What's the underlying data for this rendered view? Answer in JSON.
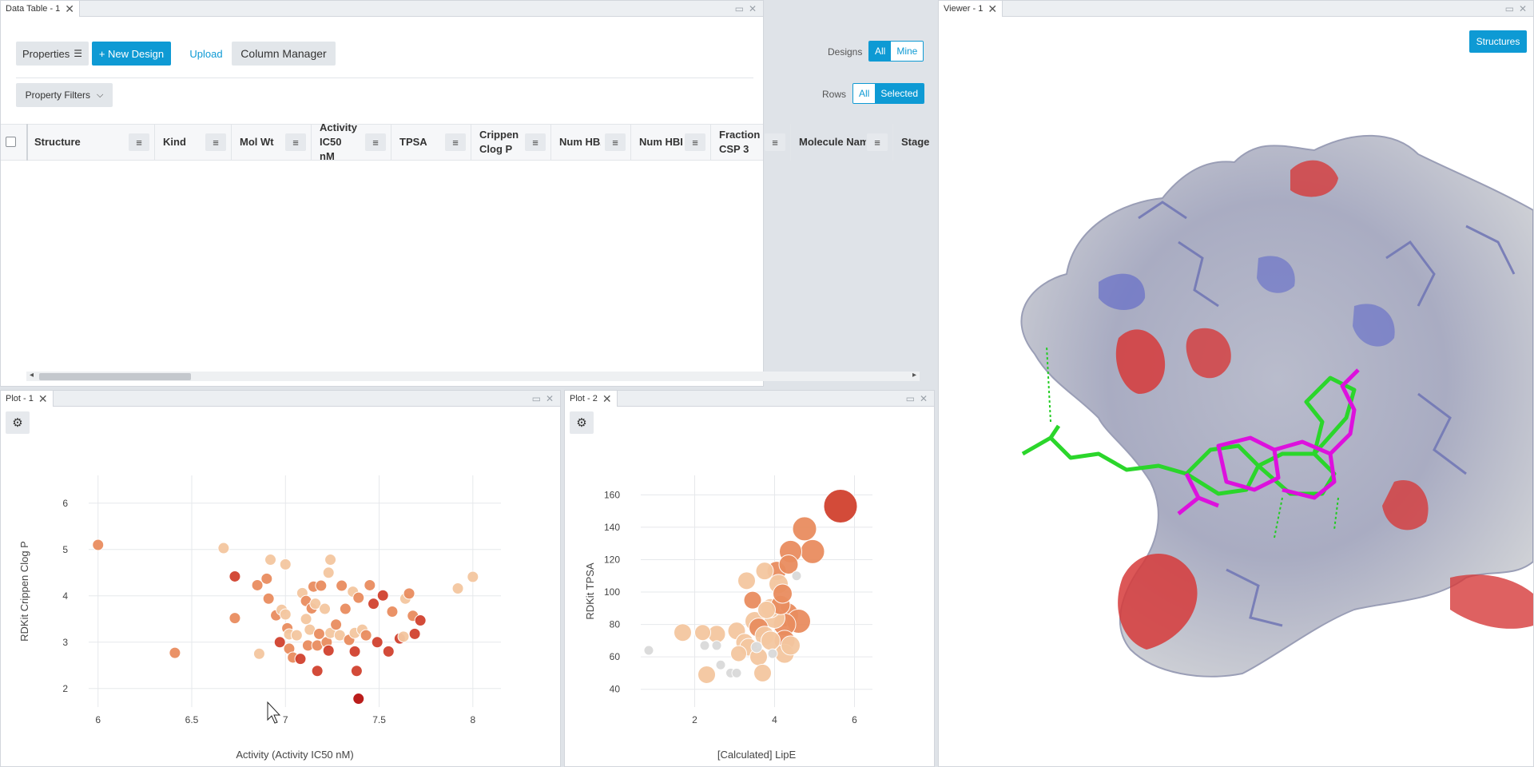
{
  "data_table": {
    "tab_title": "Data Table - 1",
    "properties_label": "Properties",
    "new_design_label": "+ New Design",
    "upload_label": "Upload",
    "column_manager_label": "Column Manager",
    "designs_label": "Designs",
    "designs_all": "All",
    "designs_mine": "Mine",
    "property_filters_label": "Property Filters",
    "rows_label": "Rows",
    "rows_all": "All",
    "rows_selected": "Selected",
    "columns": [
      {
        "label": "Structure"
      },
      {
        "label": "Kind"
      },
      {
        "label": "Mol Wt"
      },
      {
        "label": "Activity IC50\nnM"
      },
      {
        "label": "TPSA"
      },
      {
        "label": "Crippen\nClog P"
      },
      {
        "label": "Num HBA"
      },
      {
        "label": "Num HBD"
      },
      {
        "label": "Fraction\nCSP 3"
      },
      {
        "label": "Molecule Name"
      },
      {
        "label": "Stage"
      }
    ]
  },
  "plot1": {
    "tab_title": "Plot - 1",
    "icons": {
      "settings": "gear-icon"
    }
  },
  "plot2": {
    "tab_title": "Plot - 2",
    "icons": {
      "settings": "gear-icon"
    }
  },
  "viewer": {
    "tab_title": "Viewer - 1",
    "structures_label": "Structures"
  },
  "chart_data": [
    {
      "type": "scatter",
      "xlabel": "Activity (Activity IC50 nM)",
      "ylabel": "RDKit Crippen Clog P",
      "xlim": [
        5.95,
        8.15
      ],
      "ylim": [
        1.6,
        6.6
      ],
      "xticks": [
        6,
        6.5,
        7,
        7.5,
        8
      ],
      "yticks": [
        2,
        3,
        4,
        5,
        6
      ],
      "grid": true,
      "colors": [
        "#f4c7a0",
        "#e98d5f",
        "#d1422f",
        "#b7110f"
      ],
      "points": [
        {
          "x": 6.0,
          "y": 5.1,
          "c": 1
        },
        {
          "x": 6.41,
          "y": 2.77,
          "c": 1
        },
        {
          "x": 6.67,
          "y": 5.03,
          "c": 0
        },
        {
          "x": 6.73,
          "y": 4.42,
          "c": 2
        },
        {
          "x": 6.73,
          "y": 3.52,
          "c": 1
        },
        {
          "x": 6.85,
          "y": 4.23,
          "c": 1
        },
        {
          "x": 6.9,
          "y": 4.37,
          "c": 1
        },
        {
          "x": 6.91,
          "y": 3.94,
          "c": 1
        },
        {
          "x": 6.92,
          "y": 4.78,
          "c": 0
        },
        {
          "x": 6.86,
          "y": 2.75,
          "c": 0
        },
        {
          "x": 6.95,
          "y": 3.58,
          "c": 1
        },
        {
          "x": 6.98,
          "y": 3.7,
          "c": 0
        },
        {
          "x": 6.97,
          "y": 3.0,
          "c": 2
        },
        {
          "x": 7.0,
          "y": 4.68,
          "c": 0
        },
        {
          "x": 7.0,
          "y": 3.6,
          "c": 0
        },
        {
          "x": 7.01,
          "y": 3.3,
          "c": 1
        },
        {
          "x": 7.02,
          "y": 3.17,
          "c": 0
        },
        {
          "x": 7.02,
          "y": 2.86,
          "c": 1
        },
        {
          "x": 7.04,
          "y": 2.67,
          "c": 1
        },
        {
          "x": 7.06,
          "y": 3.15,
          "c": 0
        },
        {
          "x": 7.08,
          "y": 2.64,
          "c": 2
        },
        {
          "x": 7.09,
          "y": 4.06,
          "c": 0
        },
        {
          "x": 7.11,
          "y": 3.89,
          "c": 1
        },
        {
          "x": 7.11,
          "y": 3.5,
          "c": 0
        },
        {
          "x": 7.12,
          "y": 2.93,
          "c": 1
        },
        {
          "x": 7.13,
          "y": 3.27,
          "c": 0
        },
        {
          "x": 7.14,
          "y": 3.73,
          "c": 1
        },
        {
          "x": 7.15,
          "y": 4.2,
          "c": 1
        },
        {
          "x": 7.16,
          "y": 3.83,
          "c": 0
        },
        {
          "x": 7.17,
          "y": 2.93,
          "c": 1
        },
        {
          "x": 7.17,
          "y": 2.38,
          "c": 2
        },
        {
          "x": 7.18,
          "y": 3.18,
          "c": 1
        },
        {
          "x": 7.19,
          "y": 4.22,
          "c": 1
        },
        {
          "x": 7.21,
          "y": 3.72,
          "c": 0
        },
        {
          "x": 7.22,
          "y": 3.0,
          "c": 1
        },
        {
          "x": 7.23,
          "y": 2.82,
          "c": 2
        },
        {
          "x": 7.24,
          "y": 3.2,
          "c": 0
        },
        {
          "x": 7.23,
          "y": 4.5,
          "c": 0
        },
        {
          "x": 7.24,
          "y": 4.78,
          "c": 0
        },
        {
          "x": 7.27,
          "y": 3.38,
          "c": 1
        },
        {
          "x": 7.29,
          "y": 3.15,
          "c": 0
        },
        {
          "x": 7.3,
          "y": 4.22,
          "c": 1
        },
        {
          "x": 7.32,
          "y": 3.72,
          "c": 1
        },
        {
          "x": 7.34,
          "y": 3.05,
          "c": 1
        },
        {
          "x": 7.36,
          "y": 4.09,
          "c": 0
        },
        {
          "x": 7.37,
          "y": 3.2,
          "c": 0
        },
        {
          "x": 7.37,
          "y": 2.8,
          "c": 2
        },
        {
          "x": 7.38,
          "y": 2.38,
          "c": 2
        },
        {
          "x": 7.39,
          "y": 3.96,
          "c": 1
        },
        {
          "x": 7.39,
          "y": 1.78,
          "c": 3
        },
        {
          "x": 7.41,
          "y": 3.27,
          "c": 0
        },
        {
          "x": 7.43,
          "y": 3.15,
          "c": 1
        },
        {
          "x": 7.45,
          "y": 4.23,
          "c": 1
        },
        {
          "x": 7.47,
          "y": 3.83,
          "c": 2
        },
        {
          "x": 7.49,
          "y": 3.0,
          "c": 2
        },
        {
          "x": 7.52,
          "y": 4.01,
          "c": 2
        },
        {
          "x": 7.55,
          "y": 2.8,
          "c": 2
        },
        {
          "x": 7.57,
          "y": 3.66,
          "c": 1
        },
        {
          "x": 7.61,
          "y": 3.08,
          "c": 2
        },
        {
          "x": 7.63,
          "y": 3.12,
          "c": 0
        },
        {
          "x": 7.64,
          "y": 3.94,
          "c": 0
        },
        {
          "x": 7.66,
          "y": 4.05,
          "c": 1
        },
        {
          "x": 7.68,
          "y": 3.57,
          "c": 1
        },
        {
          "x": 7.69,
          "y": 3.18,
          "c": 2
        },
        {
          "x": 7.72,
          "y": 3.47,
          "c": 2
        },
        {
          "x": 7.92,
          "y": 4.16,
          "c": 0
        },
        {
          "x": 8.0,
          "y": 4.41,
          "c": 0
        }
      ]
    },
    {
      "type": "scatter",
      "xlabel": "[Calculated] LipE",
      "ylabel": "RDKit TPSA",
      "xlim": [
        0.65,
        6.45
      ],
      "ylim": [
        29,
        172
      ],
      "xticks": [
        2,
        4,
        6
      ],
      "yticks": [
        40,
        60,
        80,
        100,
        120,
        140,
        160
      ],
      "grid": true,
      "colors": [
        "#f4c7a0",
        "#e98d5f",
        "#d1422f",
        "#b7110f",
        "#dadada"
      ],
      "points": [
        {
          "x": 0.85,
          "y": 64,
          "c": 4,
          "s": 6
        },
        {
          "x": 1.7,
          "y": 75,
          "c": 0,
          "s": 11
        },
        {
          "x": 2.2,
          "y": 75,
          "c": 0,
          "s": 10
        },
        {
          "x": 2.25,
          "y": 67,
          "c": 4,
          "s": 6
        },
        {
          "x": 2.3,
          "y": 49,
          "c": 0,
          "s": 11
        },
        {
          "x": 2.55,
          "y": 67,
          "c": 4,
          "s": 6
        },
        {
          "x": 2.55,
          "y": 74,
          "c": 0,
          "s": 11
        },
        {
          "x": 2.65,
          "y": 55,
          "c": 4,
          "s": 6
        },
        {
          "x": 2.9,
          "y": 50,
          "c": 4,
          "s": 6
        },
        {
          "x": 3.05,
          "y": 76,
          "c": 0,
          "s": 11
        },
        {
          "x": 3.05,
          "y": 50,
          "c": 4,
          "s": 6
        },
        {
          "x": 3.1,
          "y": 62,
          "c": 0,
          "s": 10
        },
        {
          "x": 3.25,
          "y": 69,
          "c": 0,
          "s": 11
        },
        {
          "x": 3.3,
          "y": 107,
          "c": 0,
          "s": 11
        },
        {
          "x": 3.35,
          "y": 66,
          "c": 0,
          "s": 11
        },
        {
          "x": 3.45,
          "y": 95,
          "c": 1,
          "s": 11
        },
        {
          "x": 3.5,
          "y": 82,
          "c": 0,
          "s": 12
        },
        {
          "x": 3.55,
          "y": 66,
          "c": 4,
          "s": 7
        },
        {
          "x": 3.6,
          "y": 60,
          "c": 0,
          "s": 11
        },
        {
          "x": 3.6,
          "y": 78,
          "c": 1,
          "s": 12
        },
        {
          "x": 3.7,
          "y": 50,
          "c": 0,
          "s": 11
        },
        {
          "x": 3.75,
          "y": 113,
          "c": 0,
          "s": 11
        },
        {
          "x": 3.75,
          "y": 73,
          "c": 0,
          "s": 12
        },
        {
          "x": 3.8,
          "y": 89,
          "c": 0,
          "s": 11
        },
        {
          "x": 3.9,
          "y": 90,
          "c": 0,
          "s": 12
        },
        {
          "x": 3.9,
          "y": 70,
          "c": 0,
          "s": 12
        },
        {
          "x": 3.95,
          "y": 62,
          "c": 4,
          "s": 6
        },
        {
          "x": 4.0,
          "y": 84,
          "c": 0,
          "s": 13
        },
        {
          "x": 4.05,
          "y": 113,
          "c": 1,
          "s": 12
        },
        {
          "x": 4.1,
          "y": 105,
          "c": 0,
          "s": 12
        },
        {
          "x": 4.15,
          "y": 92,
          "c": 1,
          "s": 12
        },
        {
          "x": 4.2,
          "y": 99,
          "c": 1,
          "s": 12
        },
        {
          "x": 4.25,
          "y": 80,
          "c": 1,
          "s": 14
        },
        {
          "x": 4.25,
          "y": 70,
          "c": 1,
          "s": 13
        },
        {
          "x": 4.25,
          "y": 62,
          "c": 0,
          "s": 12
        },
        {
          "x": 4.3,
          "y": 86,
          "c": 1,
          "s": 15
        },
        {
          "x": 4.35,
          "y": 117,
          "c": 1,
          "s": 12
        },
        {
          "x": 4.4,
          "y": 67,
          "c": 0,
          "s": 12
        },
        {
          "x": 4.4,
          "y": 125,
          "c": 1,
          "s": 14
        },
        {
          "x": 4.55,
          "y": 110,
          "c": 4,
          "s": 6
        },
        {
          "x": 4.6,
          "y": 82,
          "c": 1,
          "s": 15
        },
        {
          "x": 4.75,
          "y": 139,
          "c": 1,
          "s": 15
        },
        {
          "x": 4.95,
          "y": 125,
          "c": 1,
          "s": 15
        },
        {
          "x": 5.65,
          "y": 153,
          "c": 2,
          "s": 21
        }
      ]
    }
  ]
}
